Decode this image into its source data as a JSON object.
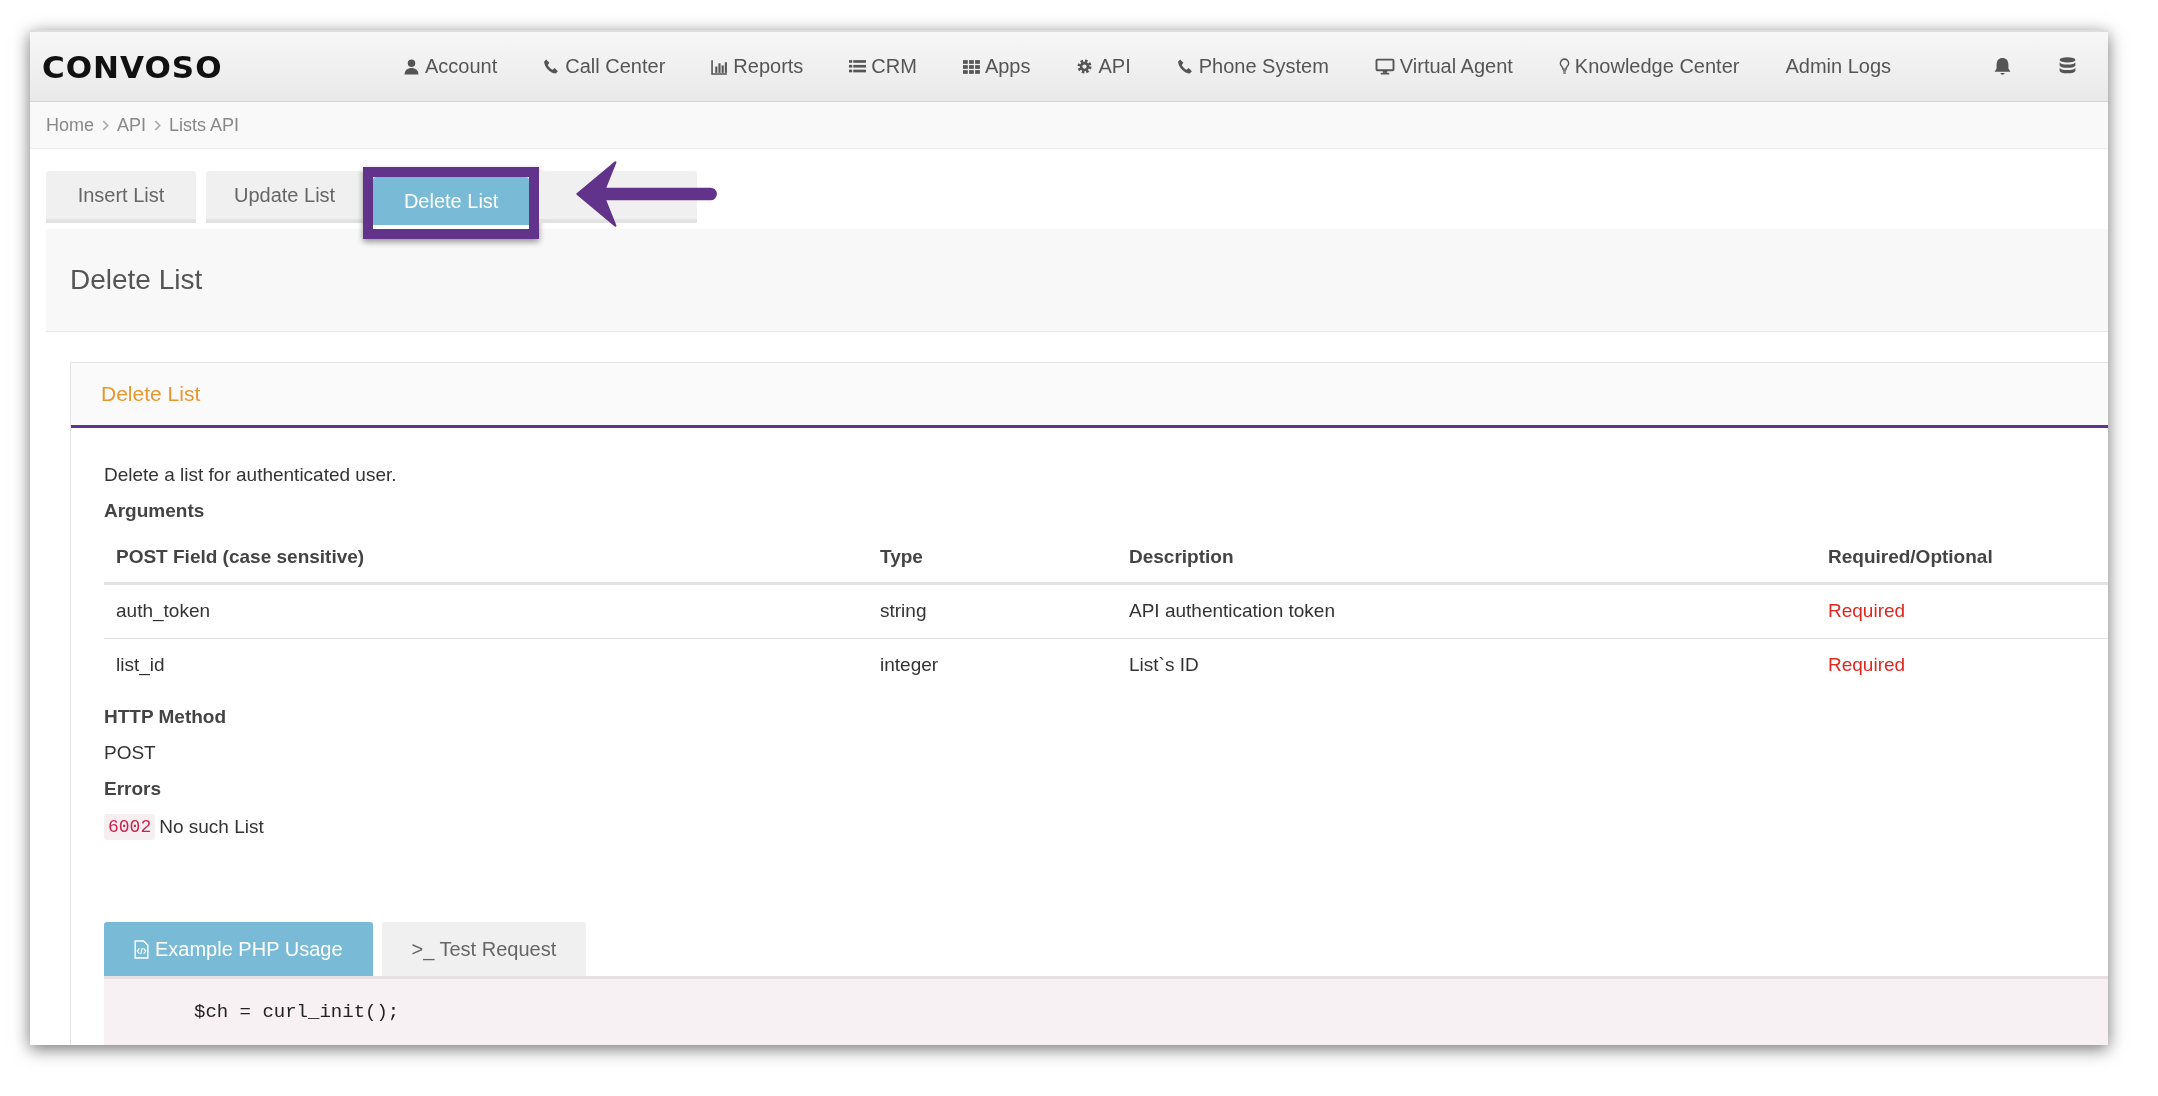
{
  "header": {
    "logo": "CONVOSO",
    "nav": [
      {
        "label": "Account"
      },
      {
        "label": "Call Center"
      },
      {
        "label": "Reports"
      },
      {
        "label": "CRM"
      },
      {
        "label": "Apps"
      },
      {
        "label": "API"
      },
      {
        "label": "Phone System"
      },
      {
        "label": "Virtual Agent"
      },
      {
        "label": "Knowledge Center"
      },
      {
        "label": "Admin Logs"
      }
    ]
  },
  "breadcrumb": [
    "Home",
    "API",
    "Lists API"
  ],
  "tabs": [
    {
      "label": "Insert List",
      "selected": false
    },
    {
      "label": "Update List",
      "selected": false
    },
    {
      "label": "Delete List",
      "selected": true
    },
    {
      "selected": false
    }
  ],
  "annotation": {
    "highlight_selected_tab": true,
    "arrow": true
  },
  "page_title": "Delete List",
  "card": {
    "title": "Delete List",
    "description": "Delete a list for authenticated user.",
    "arguments_heading": "Arguments",
    "table": {
      "columns": [
        "POST Field (case sensitive)",
        "Type",
        "Description",
        "Required/Optional"
      ],
      "rows": [
        [
          "auth_token",
          "string",
          "API authentication token",
          "Required"
        ],
        [
          "list_id",
          "integer",
          "List`s ID",
          "Required"
        ]
      ]
    },
    "method_heading": "HTTP Method",
    "method": "POST",
    "errors_heading": "Errors",
    "errors": [
      {
        "code": "6002",
        "message": "No such List"
      }
    ],
    "code_tabs": [
      {
        "label": "Example PHP Usage",
        "selected": true
      },
      {
        "label": ">_ Test Request",
        "selected": false
      }
    ],
    "code_lines": [
      "$ch = curl_init();"
    ]
  }
}
